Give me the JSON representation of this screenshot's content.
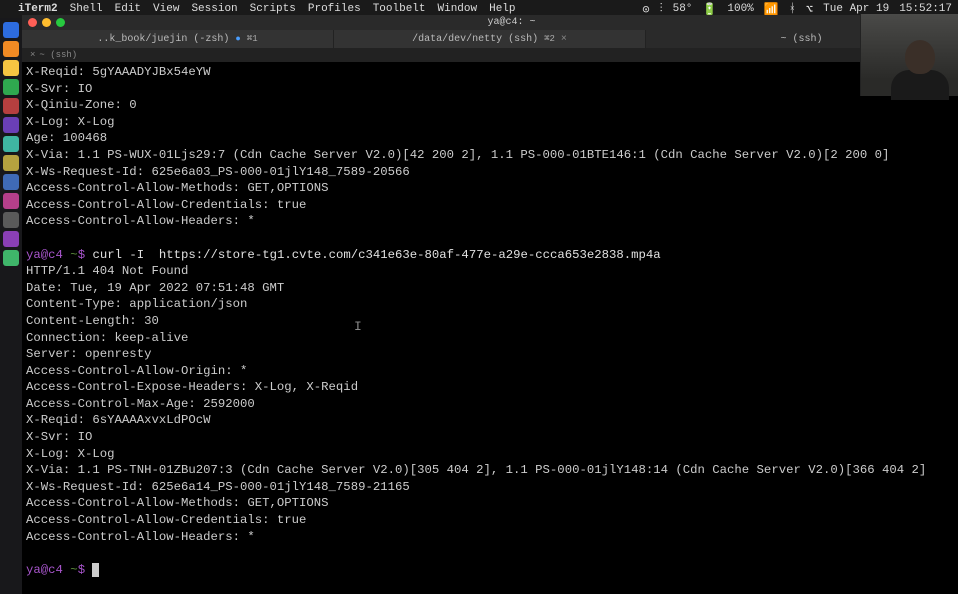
{
  "menubar": {
    "apple": "",
    "app": "iTerm2",
    "items": [
      "Shell",
      "Edit",
      "View",
      "Session",
      "Scripts",
      "Profiles",
      "Toolbelt",
      "Window",
      "Help"
    ],
    "status": {
      "weather": "58°",
      "battery": "100%",
      "wifi": "⌃",
      "bt": "⌫",
      "day": "Tue Apr 19",
      "time": "15:52:17"
    }
  },
  "window": {
    "title": "ya@c4: ~"
  },
  "tabs": [
    {
      "label": "..k_book/juejin (-zsh)",
      "badge": "⌘1",
      "closable": true
    },
    {
      "label": "/data/dev/netty (ssh)",
      "badge": "⌘2",
      "closable": true
    },
    {
      "label": "~ (ssh)",
      "badge": "",
      "closable": false
    }
  ],
  "subtab": {
    "label": "~ (ssh)",
    "close": "×"
  },
  "prompt": {
    "userhost": "ya@c4",
    "path": "~",
    "symbol": "$"
  },
  "block1": [
    "X-Reqid: 5gYAAADYJBx54eYW",
    "X-Svr: IO",
    "X-Qiniu-Zone: 0",
    "X-Log: X-Log",
    "Age: 100468",
    "X-Via: 1.1 PS-WUX-01Ljs29:7 (Cdn Cache Server V2.0)[42 200 2], 1.1 PS-000-01BTE146:1 (Cdn Cache Server V2.0)[2 200 0]",
    "X-Ws-Request-Id: 625e6a03_PS-000-01jlY148_7589-20566",
    "Access-Control-Allow-Methods: GET,OPTIONS",
    "Access-Control-Allow-Credentials: true",
    "Access-Control-Allow-Headers: *"
  ],
  "cmd1": "curl -I  https://store-tg1.cvte.com/c341e63e-80af-477e-a29e-ccca653e2838.mp4a",
  "block2": [
    "HTTP/1.1 404 Not Found",
    "Date: Tue, 19 Apr 2022 07:51:48 GMT",
    "Content-Type: application/json",
    "Content-Length: 30",
    "Connection: keep-alive",
    "Server: openresty",
    "Access-Control-Allow-Origin: *",
    "Access-Control-Expose-Headers: X-Log, X-Reqid",
    "Access-Control-Max-Age: 2592000",
    "X-Reqid: 6sYAAAAxvxLdPOcW",
    "X-Svr: IO",
    "X-Log: X-Log",
    "X-Via: 1.1 PS-TNH-01ZBu207:3 (Cdn Cache Server V2.0)[305 404 2], 1.1 PS-000-01jlY148:14 (Cdn Cache Server V2.0)[366 404 2]",
    "X-Ws-Request-Id: 625e6a14_PS-000-01jlY148_7589-21165",
    "Access-Control-Allow-Methods: GET,OPTIONS",
    "Access-Control-Allow-Credentials: true",
    "Access-Control-Allow-Headers: *"
  ],
  "dock_colors": [
    "#2d6cdf",
    "#f08a24",
    "#f5c542",
    "#2fa84f",
    "#b53f3f",
    "#6a3fb5",
    "#3fb5a2",
    "#b5a23f",
    "#3f6ab5",
    "#b53f8a",
    "#5a5a5a",
    "#8a3fb5",
    "#3fb56a"
  ]
}
